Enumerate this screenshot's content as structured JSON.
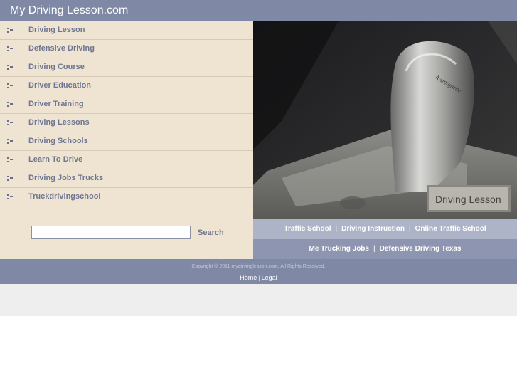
{
  "header": {
    "site_title": "My Driving Lesson.com"
  },
  "sidebar": {
    "items": [
      {
        "label": "Driving Lesson"
      },
      {
        "label": "Defensive Driving"
      },
      {
        "label": "Driving Course"
      },
      {
        "label": "Driver Education"
      },
      {
        "label": "Driver Training"
      },
      {
        "label": "Driving Lessons"
      },
      {
        "label": "Driving Schools"
      },
      {
        "label": "Learn To Drive"
      },
      {
        "label": "Driving Jobs Trucks"
      },
      {
        "label": "Truckdrivingschool"
      }
    ],
    "bullet_icon": "dot-grid-icon"
  },
  "search": {
    "value": "",
    "placeholder": "",
    "button_label": "Search"
  },
  "hero": {
    "caption": "Driving Lesson",
    "image": "gear-shifter-photo",
    "shifter_text": "Avantgarde"
  },
  "related_links": {
    "row1": [
      "Traffic School",
      "Driving Instruction",
      "Online Traffic School"
    ],
    "row2": [
      "Me Trucking Jobs",
      "Defensive Driving Texas"
    ],
    "separator": "|"
  },
  "footer": {
    "copyright": "Copyright © 2011 mydrivinglesson.com. All Rights Reserved.",
    "links": [
      "Home",
      "Legal"
    ],
    "separator": "|"
  },
  "colors": {
    "header_bg": "#7f88a4",
    "sidebar_bg": "#efe3d1",
    "link_color": "#6e7693",
    "links_row1_bg": "#aeb4c8",
    "links_row2_bg": "#8d95b0"
  }
}
